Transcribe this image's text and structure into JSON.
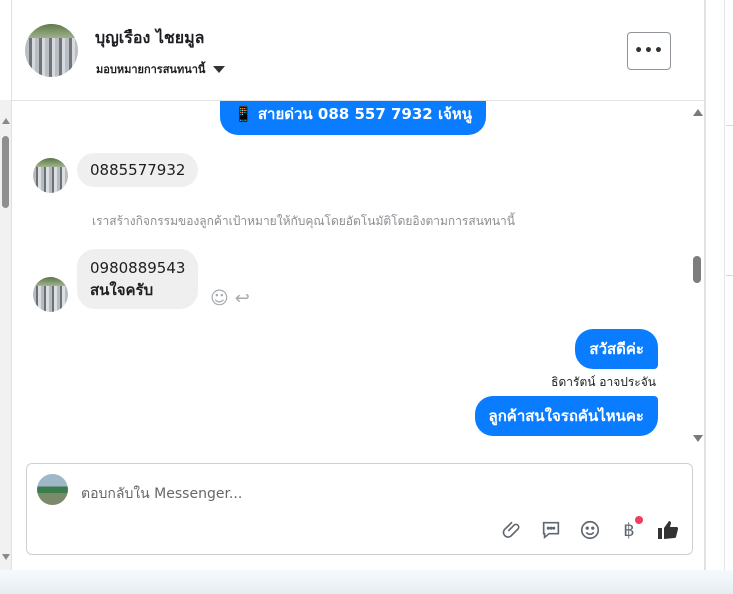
{
  "contact": {
    "name": "บุญเรือง ไชยมูล",
    "assignment": "มอบหมายการสนทนานี้"
  },
  "messages": [
    {
      "direction": "out",
      "text": "📱 สายด่วน 088 557 7932 เจ้หนู"
    },
    {
      "direction": "in",
      "text": "0885577932"
    },
    {
      "direction": "system",
      "text": "เราสร้างกิจกรรมของลูกค้าเป้าหมายให้กับคุณโดยอัตโนมัติโดยอิงตามการสนทนานี้"
    },
    {
      "direction": "in",
      "text_line1": "0980889543",
      "text_line2": "สนใจครับ"
    },
    {
      "direction": "out",
      "text": "สวัสดีค่ะ"
    },
    {
      "direction": "sender",
      "text": "ธิดารัตน์ อาจประจัน"
    },
    {
      "direction": "out",
      "text": "ลูกค้าสนใจรถคันไหนคะ"
    }
  ],
  "composer": {
    "placeholder": "ตอบกลับใน Messenger...",
    "icons": [
      "paperclip-icon",
      "chat-bubble-icon",
      "emoji-icon",
      "baht-icon",
      "thumbs-up-icon"
    ]
  },
  "colors": {
    "accent": "#0a7cff",
    "incoming_bubble": "#efefef",
    "notification_dot": "#f03e5c"
  }
}
